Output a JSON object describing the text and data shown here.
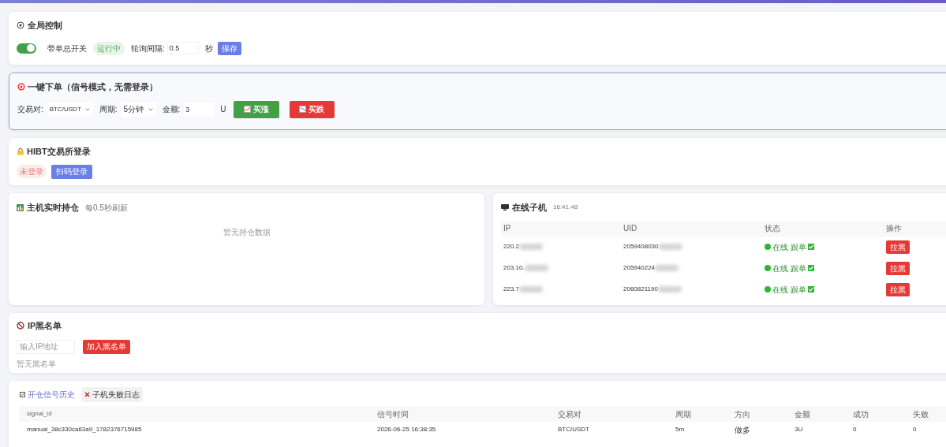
{
  "global_control": {
    "title": "全局控制",
    "switch_label": "带单总开关",
    "switch_on": true,
    "status_badge": "运行中",
    "interval_label": "轮询间隔:",
    "interval_value": "0.5",
    "interval_unit": "秒",
    "save_button": "保存"
  },
  "quick_order": {
    "title": "一键下单（信号模式，无需登录）",
    "pair_label": "交易对:",
    "pair_value": "BTC/USDT",
    "period_label": "周期:",
    "period_value": "5分钟",
    "amount_label": "金额:",
    "amount_value": "3",
    "amount_unit": "U",
    "buy_button": "买涨",
    "sell_button": "买跌"
  },
  "exchange_login": {
    "title": "HIBT交易所登录",
    "status_badge": "未登录",
    "login_button": "扫码登录"
  },
  "positions": {
    "title": "主机实时持仓",
    "subtitle": "每0.5秒刷新",
    "empty_text": "暂无持仓数据"
  },
  "online_clients": {
    "title": "在线子机",
    "time": "16:41:48",
    "columns": [
      "IP",
      "UID",
      "状态",
      "操作"
    ],
    "rows": [
      {
        "ip": "220.2",
        "uid": "2059408030",
        "status": "在线 跟单",
        "online": true,
        "following": true,
        "action": "拉黑"
      },
      {
        "ip": "203.10.",
        "uid": "205940224",
        "status": "在线 跟单",
        "online": true,
        "following": true,
        "action": "拉黑"
      },
      {
        "ip": "223.7",
        "uid": "2060821190",
        "status": "在线 跟单",
        "online": true,
        "following": true,
        "action": "拉黑"
      }
    ]
  },
  "ip_blacklist": {
    "title": "IP黑名单",
    "placeholder": "输入IP地址",
    "add_button": "加入黑名单",
    "empty_text": "暂无黑名单"
  },
  "history": {
    "tabs": [
      {
        "label": "开仓信号历史",
        "selected": true,
        "kind": "check"
      },
      {
        "label": "子机失败日志",
        "selected": false,
        "kind": "cross"
      }
    ],
    "columns": [
      "signal_id",
      "信号时间",
      "交易对",
      "周期",
      "方向",
      "金额",
      "成功",
      "失败"
    ],
    "rows": [
      [
        "manual_38c330ca63a9_1782376715985",
        "2026-06-25 16:38:35",
        "BTC/USDT",
        "5m",
        "做多",
        "3U",
        "0",
        "0"
      ]
    ]
  }
}
